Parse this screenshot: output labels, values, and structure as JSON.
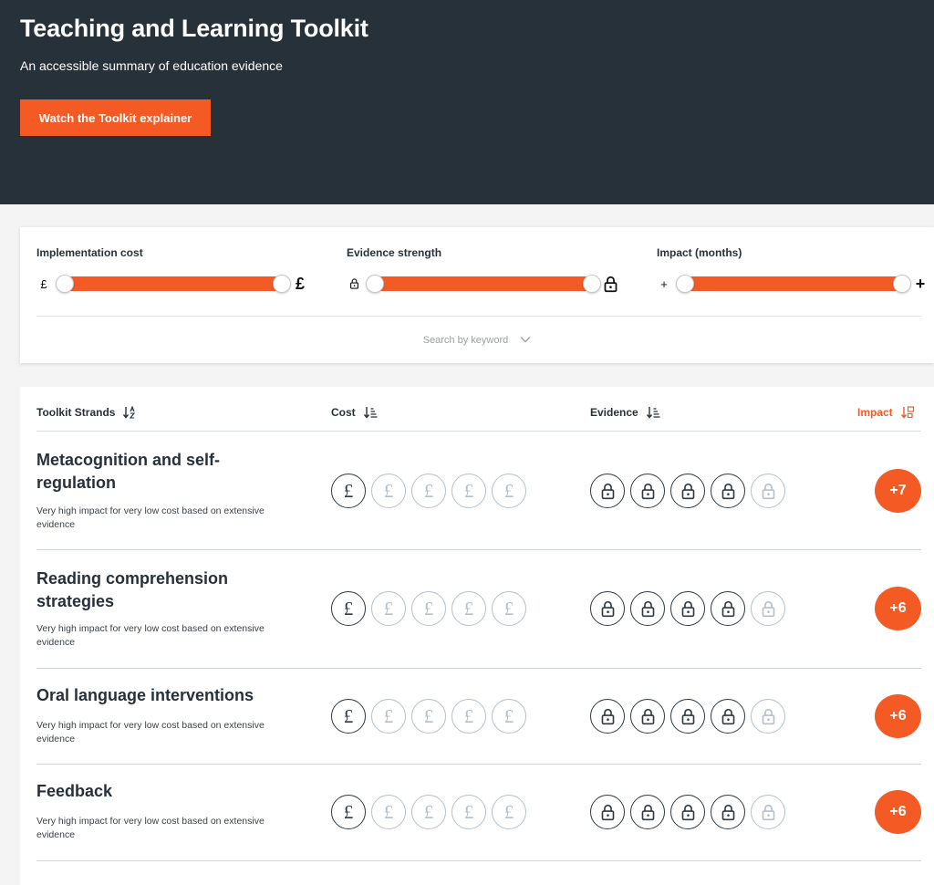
{
  "hero": {
    "title": "Teaching and Learning Toolkit",
    "subtitle": "An accessible summary of education evidence",
    "cta_label": "Watch the Toolkit explainer"
  },
  "filters": {
    "cost": {
      "label": "Implementation cost",
      "min_symbol": "£",
      "max_symbol": "£",
      "range": [
        1,
        5
      ]
    },
    "evidence": {
      "label": "Evidence strength",
      "min_icon": "padlock-icon",
      "max_icon": "padlock-icon",
      "range": [
        1,
        5
      ]
    },
    "impact": {
      "label": "Impact (months)",
      "min_symbol": "+",
      "max_symbol": "+",
      "range": [
        0,
        8
      ]
    },
    "search_label": "Search by keyword"
  },
  "table": {
    "headers": {
      "strand": "Toolkit Strands",
      "cost": "Cost",
      "evidence": "Evidence",
      "impact": "Impact"
    },
    "active_sort": "impact",
    "rows": [
      {
        "title": "Metacognition and self-regulation",
        "description": "Very high impact for very low cost based on extensive evidence",
        "cost_level": 1,
        "evidence_level": 4,
        "impact": "+7"
      },
      {
        "title": "Reading comprehension strategies",
        "description": "Very high impact for very low cost based on extensive evidence",
        "cost_level": 1,
        "evidence_level": 4,
        "impact": "+6"
      },
      {
        "title": "Oral language interventions",
        "description": "Very high impact for very low cost based on extensive evidence",
        "cost_level": 1,
        "evidence_level": 4,
        "impact": "+6"
      },
      {
        "title": "Feedback",
        "description": "Very high impact for very low cost based on extensive evidence",
        "cost_level": 1,
        "evidence_level": 4,
        "impact": "+6"
      }
    ]
  },
  "colors": {
    "accent": "#f45a24",
    "hero_bg": "#27313a",
    "icon_active": "#2f3a44",
    "icon_inactive": "#b5c0ca"
  }
}
